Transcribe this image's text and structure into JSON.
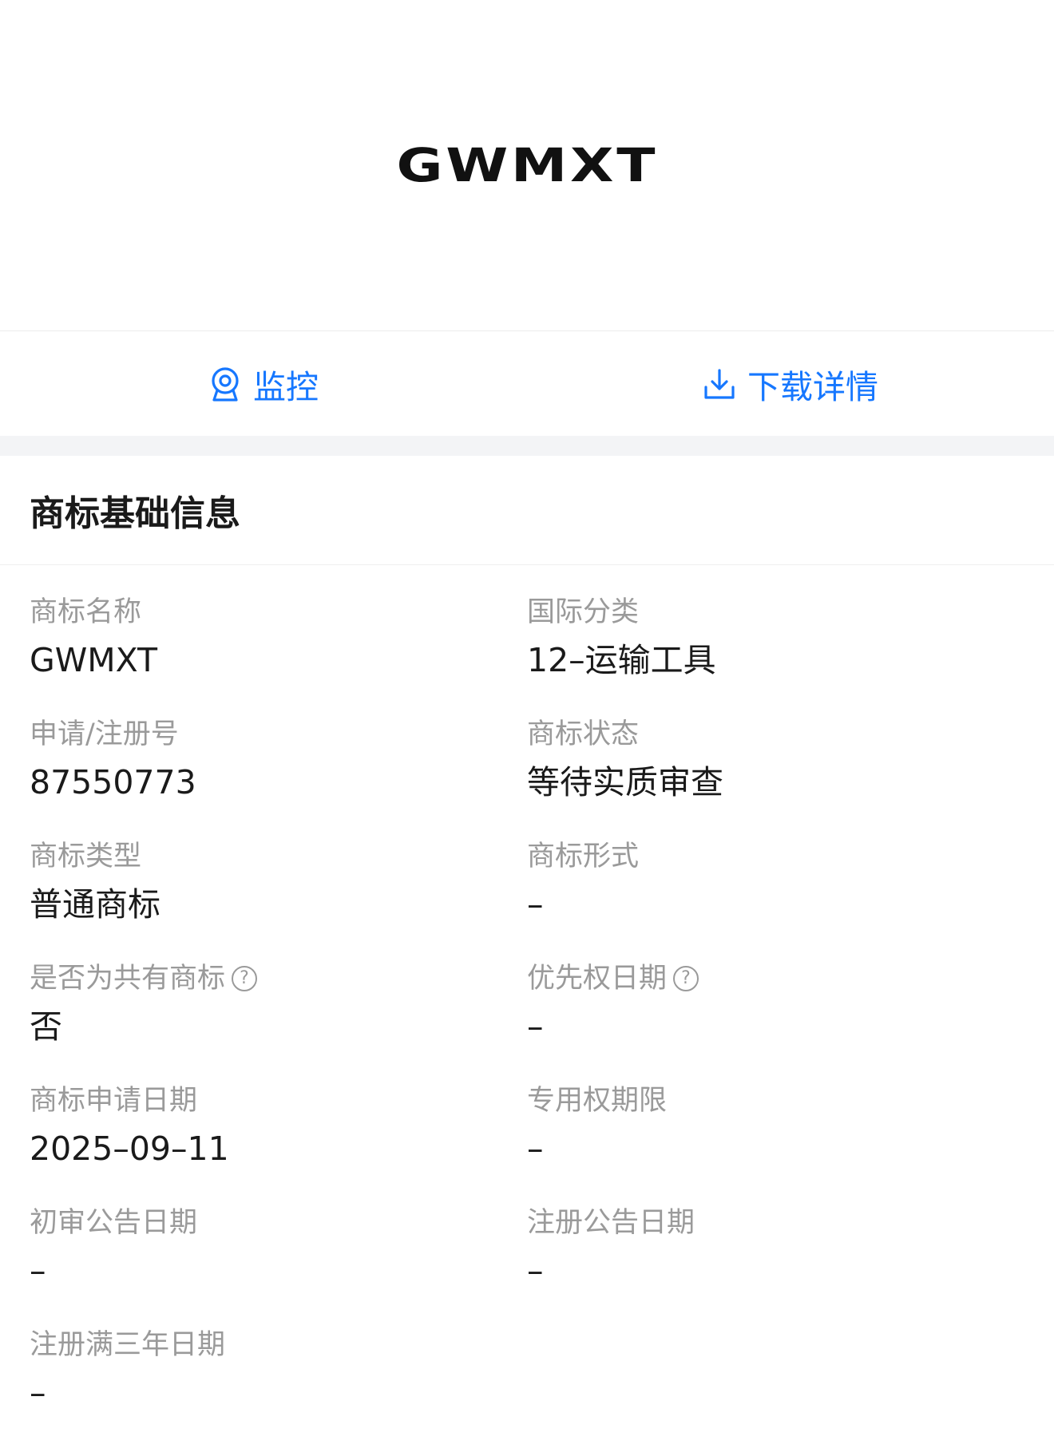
{
  "trademark_image": {
    "text": "GWMXT"
  },
  "actions": {
    "monitor": {
      "label": "监控",
      "icon": "monitor-icon"
    },
    "download": {
      "label": "下载详情",
      "icon": "download-icon"
    }
  },
  "colors": {
    "accent": "#1677ff",
    "label": "#9a9a9a",
    "band": "#f3f4f6"
  },
  "section": {
    "title": "商标基础信息"
  },
  "fields": {
    "name": {
      "label": "商标名称",
      "value": "GWMXT"
    },
    "intl_class": {
      "label": "国际分类",
      "value": "12–运输工具"
    },
    "reg_no": {
      "label": "申请/注册号",
      "value": "87550773"
    },
    "status": {
      "label": "商标状态",
      "value": "等待实质审查"
    },
    "type": {
      "label": "商标类型",
      "value": "普通商标"
    },
    "form": {
      "label": "商标形式",
      "value": "–"
    },
    "shared": {
      "label": "是否为共有商标",
      "value": "否",
      "help": "?"
    },
    "priority_date": {
      "label": "优先权日期",
      "value": "–",
      "help": "?"
    },
    "apply_date": {
      "label": "商标申请日期",
      "value": "2025–09–11"
    },
    "exclusive_period": {
      "label": "专用权期限",
      "value": "–"
    },
    "prelim_date": {
      "label": "初审公告日期",
      "value": "–"
    },
    "reg_announce_date": {
      "label": "注册公告日期",
      "value": "–"
    },
    "three_year_date": {
      "label": "注册满三年日期",
      "value": "–"
    }
  }
}
